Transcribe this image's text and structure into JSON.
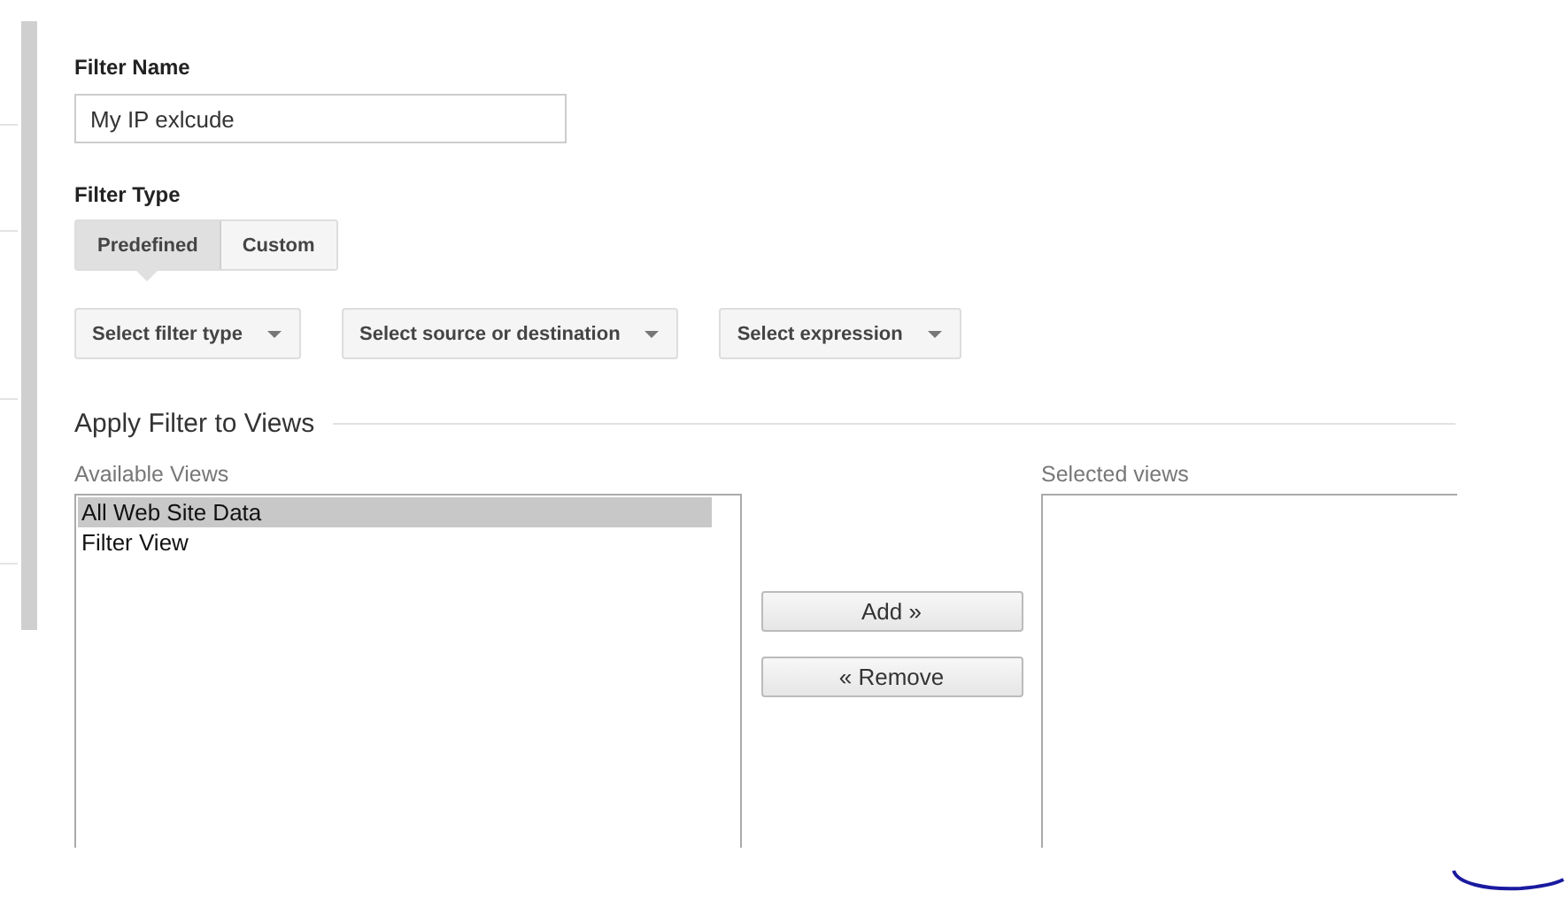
{
  "filter_name": {
    "label": "Filter Name",
    "value": "My IP exlcude"
  },
  "filter_type": {
    "label": "Filter Type",
    "tabs": [
      {
        "label": "Predefined",
        "selected": true
      },
      {
        "label": "Custom",
        "selected": false
      }
    ],
    "dropdowns": [
      "Select filter type",
      "Select source or destination",
      "Select expression"
    ]
  },
  "apply_section": {
    "title": "Apply Filter to Views",
    "available_views": {
      "label": "Available Views",
      "items": [
        {
          "label": "All Web Site Data",
          "selected": true
        },
        {
          "label": "Filter View",
          "selected": false
        }
      ]
    },
    "buttons": [
      "Add »",
      "« Remove"
    ],
    "selected_views": {
      "label": "Selected views"
    }
  }
}
